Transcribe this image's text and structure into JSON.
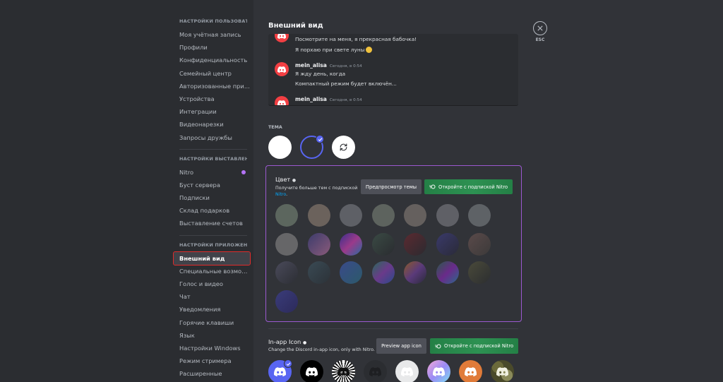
{
  "sidebar": {
    "sections": [
      {
        "header": "НАСТРОЙКИ ПОЛЬЗОВАТЕ...",
        "items": [
          "Моя учётная запись",
          "Профили",
          "Конфиденциальность",
          "Семейный центр",
          "Авторизованные при...",
          "Устройства",
          "Интеграции",
          "Видеонарезки",
          "Запросы дружбы"
        ]
      },
      {
        "header": "НАСТРОЙКИ ВЫСТАВЛЕН...",
        "items": [
          "Nitro",
          "Буст сервера",
          "Подписки",
          "Склад подарков",
          "Выставление счетов"
        ]
      },
      {
        "header": "НАСТРОЙКИ ПРИЛОЖЕНИЯ",
        "items": [
          "Внешний вид",
          "Специальные возмож...",
          "Голос и видео",
          "Чат",
          "Уведомления",
          "Горячие клавиши",
          "Язык",
          "Настройки Windows",
          "Режим стримера",
          "Расширенные"
        ]
      }
    ],
    "active_item": "Внешний вид"
  },
  "page": {
    "title": "Внешний вид"
  },
  "chat_preview": {
    "top_lines": [
      "Посмотрите на меня, я прекрасная бабочка!",
      "Я порхаю при свете луны"
    ],
    "messages": [
      {
        "author": "mein_alisa",
        "time": "Сегодня, в 0:54",
        "lines": [
          "Я жду день, когда",
          "Компактный режим будет включён..."
        ]
      },
      {
        "author": "mein_alisa",
        "time": "Сегодня, в 0:54",
        "lines": []
      }
    ]
  },
  "theme": {
    "label": "ТЕМА",
    "options": [
      {
        "name": "light",
        "color": "#ffffff"
      },
      {
        "name": "dark",
        "color": "#313338",
        "selected": true
      },
      {
        "name": "sync",
        "color": "#ffffff"
      }
    ]
  },
  "color_section": {
    "title": "Цвет",
    "desc": "Получите больше тем с подпиской",
    "link": "Nitro",
    "link_suffix": ".",
    "preview_button": "Предпросмотр темы",
    "nitro_button": "Откройте с подпиской Nitro",
    "swatches": [
      "#5c665e",
      "#6b625c",
      "#5e6066",
      "#5d635e",
      "#65605e",
      "#5f6066",
      "#5e6266",
      "#666668",
      "linear-gradient(135deg,#3c3c6c,#8a5a7a)",
      "linear-gradient(135deg,#3a2f8a,#9a3a8a,#2a6aa0)",
      "linear-gradient(135deg,#3a4a44,#2a2c30)",
      "linear-gradient(135deg,#5a2a30,#2c2a30)",
      "linear-gradient(135deg,#3a3a6a,#2a2a38)",
      "linear-gradient(135deg,#5a4a4a,#3c3a3a)",
      "linear-gradient(135deg,#4a4a5a,#2c2e34)",
      "linear-gradient(135deg,#3a4a54,#2c3238)",
      "linear-gradient(135deg,#3a4a8a,#2c5a6a)",
      "linear-gradient(135deg,#2a6a5a,#6a3a8a,#2a4a8a)",
      "linear-gradient(135deg,#8a5a2a,#5a3a7a,#2a2a3a)",
      "linear-gradient(135deg,#2a5a4a,#6a2a8a,#2a6a8a)",
      "linear-gradient(135deg,#4a4a3a,#2c2e30)",
      "linear-gradient(135deg,#3a3c7a,#2c2a5a)"
    ]
  },
  "app_icon": {
    "title": "In-app Icon",
    "desc": "Change the Discord in-app icon, only with Nitro.",
    "preview_button": "Preview app icon",
    "nitro_button": "Откройте с подпиской Nitro",
    "icons": [
      "default",
      "black",
      "sunburst",
      "dark-grey",
      "white",
      "holo",
      "pirate",
      "camo"
    ]
  },
  "close": {
    "label": "ESC"
  },
  "colors": {
    "accent": "#5865f2",
    "green": "#248046",
    "nitro_border": "#9b59d0",
    "active_outline": "#e02b2b"
  }
}
